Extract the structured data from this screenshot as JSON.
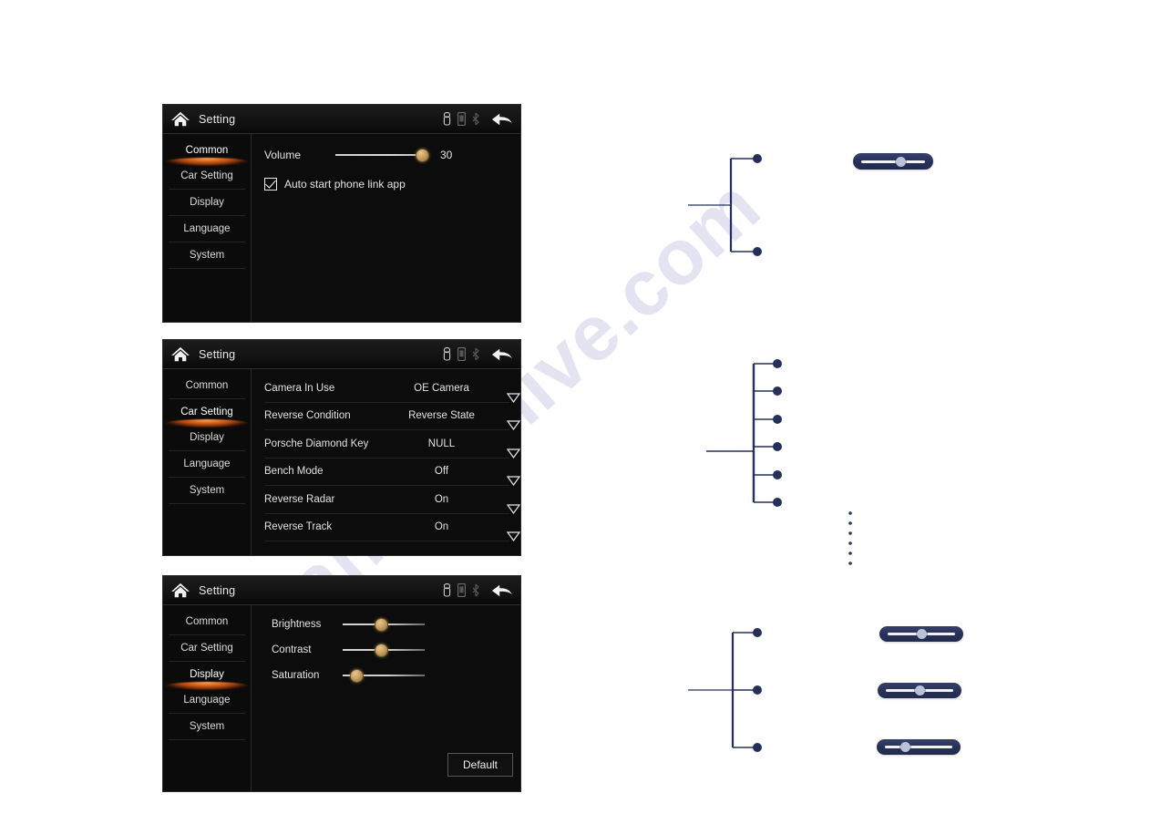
{
  "page": {
    "watermark": "manualshive.com",
    "background_color": "#ffffff",
    "accent_color": "#e8762a",
    "callout_color": "#25305a",
    "knob_color": "#c9a164"
  },
  "screens": [
    {
      "id": "common",
      "titlebar": {
        "title": "Setting",
        "home_icon": "home-icon",
        "status_icons": [
          "usb-icon",
          "phone-icon",
          "bluetooth-icon"
        ],
        "back_icon": "back-arrow-icon"
      },
      "sidebar": {
        "items": [
          {
            "label": "Common",
            "active": true
          },
          {
            "label": "Car Setting",
            "active": false
          },
          {
            "label": "Display",
            "active": false
          },
          {
            "label": "Language",
            "active": false
          },
          {
            "label": "System",
            "active": false
          }
        ]
      },
      "content": {
        "volume": {
          "label": "Volume",
          "value": "30",
          "percent": 96
        },
        "auto_start": {
          "label": "Auto start phone link app",
          "checked": true
        }
      }
    },
    {
      "id": "car-setting",
      "titlebar": {
        "title": "Setting",
        "home_icon": "home-icon",
        "status_icons": [
          "usb-icon",
          "phone-icon",
          "bluetooth-icon"
        ],
        "back_icon": "back-arrow-icon"
      },
      "sidebar": {
        "items": [
          {
            "label": "Common",
            "active": false
          },
          {
            "label": "Car Setting",
            "active": true
          },
          {
            "label": "Display",
            "active": false
          },
          {
            "label": "Language",
            "active": false
          },
          {
            "label": "System",
            "active": false
          }
        ]
      },
      "content": {
        "rows": [
          {
            "name": "Camera In Use",
            "value": "OE Camera"
          },
          {
            "name": "Reverse Condition",
            "value": "Reverse State"
          },
          {
            "name": "Porsche Diamond Key",
            "value": "NULL"
          },
          {
            "name": "Bench Mode",
            "value": "Off"
          },
          {
            "name": "Reverse Radar",
            "value": "On"
          },
          {
            "name": "Reverse Track",
            "value": "On"
          }
        ]
      }
    },
    {
      "id": "display",
      "titlebar": {
        "title": "Setting",
        "home_icon": "home-icon",
        "status_icons": [
          "usb-icon",
          "phone-icon",
          "bluetooth-icon"
        ],
        "back_icon": "back-arrow-icon"
      },
      "sidebar": {
        "items": [
          {
            "label": "Common",
            "active": false
          },
          {
            "label": "Car Setting",
            "active": false
          },
          {
            "label": "Display",
            "active": true
          },
          {
            "label": "Language",
            "active": false
          },
          {
            "label": "System",
            "active": false
          }
        ]
      },
      "content": {
        "sliders": [
          {
            "label": "Brightness",
            "percent": 46
          },
          {
            "label": "Contrast",
            "percent": 46
          },
          {
            "label": "Saturation",
            "percent": 16
          }
        ],
        "default_button": "Default"
      }
    }
  ],
  "callouts": [
    {
      "id": "callout-common",
      "branch_count": 2
    },
    {
      "id": "callout-car",
      "branch_count": 6
    },
    {
      "id": "callout-display",
      "branch_count": 3
    }
  ],
  "pill_sliders": [
    {
      "id": "pill-volume",
      "percent": 62
    },
    {
      "id": "pill-brightness",
      "percent": 50
    },
    {
      "id": "pill-contrast",
      "percent": 50
    },
    {
      "id": "pill-saturation",
      "percent": 30
    }
  ]
}
